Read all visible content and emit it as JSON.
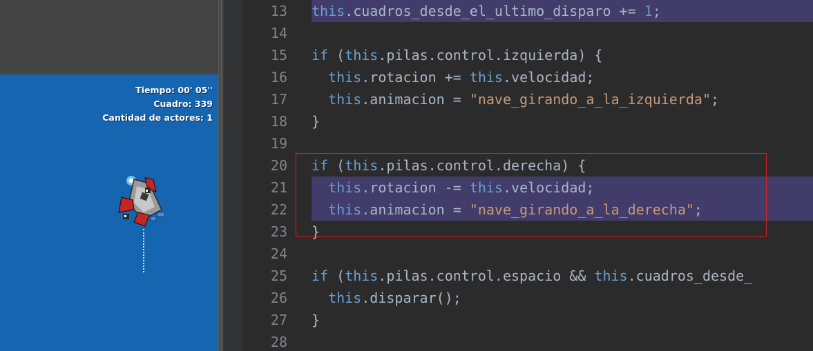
{
  "game": {
    "hud": {
      "time": "Tiempo: 00' 05''",
      "frame": "Cuadro: 339",
      "actors": "Cantidad de actores: 1"
    }
  },
  "editor": {
    "lines": [
      {
        "n": "13",
        "code": "this.cuadros_desde_el_ultimo_disparo += 1;",
        "highlight": true
      },
      {
        "n": "14",
        "code": ""
      },
      {
        "n": "15",
        "code": "if (this.pilas.control.izquierda) {"
      },
      {
        "n": "16",
        "code": "  this.rotacion += this.velocidad;"
      },
      {
        "n": "17",
        "code": "  this.animacion = \"nave_girando_a_la_izquierda\";"
      },
      {
        "n": "18",
        "code": "}"
      },
      {
        "n": "19",
        "code": ""
      },
      {
        "n": "20",
        "code": "if (this.pilas.control.derecha) {"
      },
      {
        "n": "21",
        "code": "  this.rotacion -= this.velocidad;",
        "highlight": true
      },
      {
        "n": "22",
        "code": "  this.animacion = \"nave_girando_a_la_derecha\";",
        "highlight": true
      },
      {
        "n": "23",
        "code": "}"
      },
      {
        "n": "24",
        "code": ""
      },
      {
        "n": "25",
        "code": "if (this.pilas.control.espacio && this.cuadros_desde_"
      },
      {
        "n": "26",
        "code": "  this.disparar();"
      },
      {
        "n": "27",
        "code": "}"
      },
      {
        "n": "28",
        "code": ""
      }
    ],
    "colors": {
      "keyword": "#6a9fd4",
      "string": "#c89a78",
      "number": "#6897bb",
      "default": "#a9b7c6",
      "line_highlight": "#423c6a",
      "annotation_box": "#d92020"
    }
  }
}
